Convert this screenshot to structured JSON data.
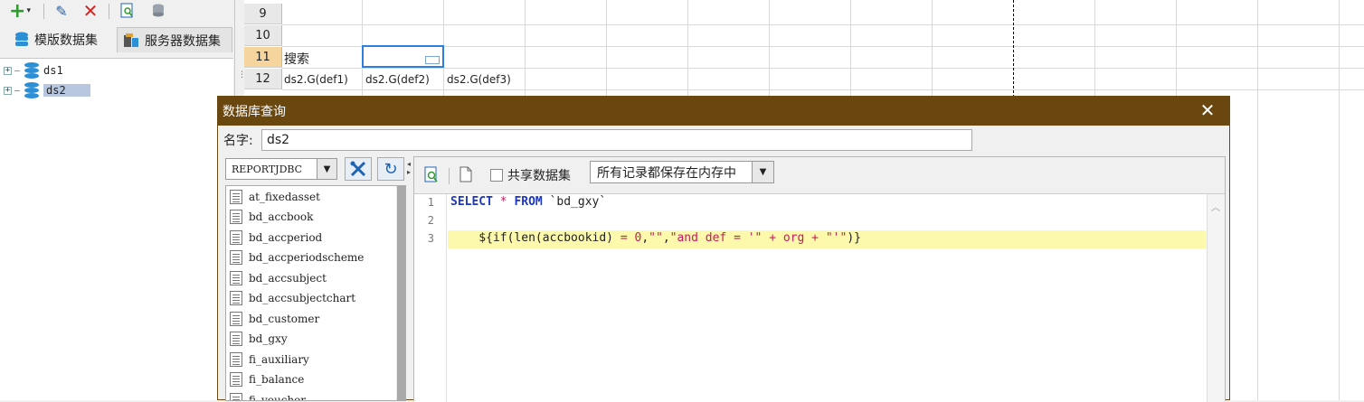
{
  "left_panel": {
    "tabs": [
      {
        "label": "模版数据集"
      },
      {
        "label": "服务器数据集"
      }
    ],
    "tree": [
      {
        "label": "ds1",
        "expander": "+"
      },
      {
        "label": "ds2",
        "expander": "+"
      }
    ]
  },
  "grid": {
    "rows": [
      "9",
      "10",
      "11",
      "12"
    ],
    "cells": {
      "r11_a": "搜索",
      "r12_a": "ds2.G(def1)",
      "r12_b": "ds2.G(def2)",
      "r12_c": "ds2.G(def3)"
    }
  },
  "dialog": {
    "title": "数据库查询",
    "close_glyph": "✕",
    "name_label": "名字:",
    "name_value": "ds2",
    "connection": "REPORTJDBC",
    "share_label": "共享数据集",
    "memory_option": "所有记录都保存在内存中",
    "tables": [
      "at_fixedasset",
      "bd_accbook",
      "bd_accperiod",
      "bd_accperiodscheme",
      "bd_accsubject",
      "bd_accsubjectchart",
      "bd_customer",
      "bd_gxy",
      "fi_auxiliary",
      "fi_balance",
      "fi_voucher"
    ],
    "sql": {
      "line_numbers": [
        "1",
        "2",
        "3"
      ],
      "line1": {
        "kw1": "SELECT",
        "op1": " * ",
        "kw2": "FROM",
        "rest": " `bd_gxy`"
      },
      "line3": {
        "p1": "    ${if(len(accbookid) ",
        "p2": "=",
        "p3": " ",
        "p4": "0",
        "p5": ",",
        "p6": "\"\"",
        "p7": ",",
        "p8": "\"and def = '\" + org + \"'\"",
        "p9": ")}"
      }
    }
  },
  "colors": {
    "title_bar": "#6b4710",
    "highlight_row_header": "#f6d49e",
    "current_line": "#fcf9ad",
    "keyword": "#1b36c9",
    "string": "#c71c5b"
  }
}
